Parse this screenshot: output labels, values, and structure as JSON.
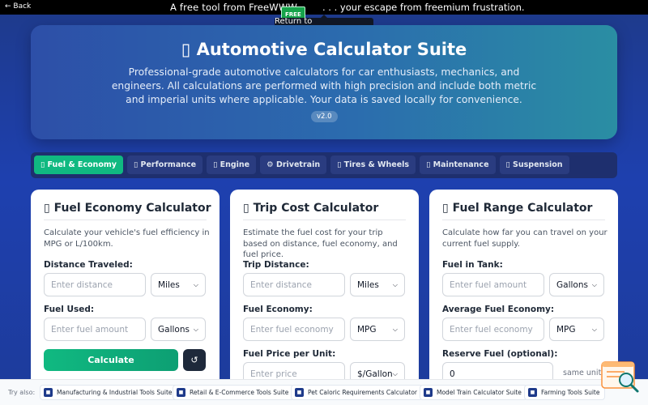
{
  "topbar": {
    "back_label": "← Back",
    "banner_text": "A free tool from FreeWWW",
    "logo_text": "FREE",
    "banner_tail": ". . . your escape from freemium frustration.",
    "return_tooltip": "Return to FreeWWW.com"
  },
  "hero": {
    "title": "▯ Automotive Calculator Suite",
    "description": "Professional-grade automotive calculators for car enthusiasts, mechanics, and engineers. All calculations are performed with high precision and include both metric and imperial units where applicable. Your data is saved locally for convenience.",
    "version": "v2.0"
  },
  "tabs": [
    {
      "label": "▯ Fuel & Economy"
    },
    {
      "label": "▯ Performance"
    },
    {
      "label": "▯ Engine"
    },
    {
      "label": "⚙ Drivetrain"
    },
    {
      "label": "▯ Tires & Wheels"
    },
    {
      "label": "▯ Maintenance"
    },
    {
      "label": "▯ Suspension"
    }
  ],
  "cards": {
    "fuel_economy": {
      "title": "▯ Fuel Economy Calculator",
      "description": "Calculate your vehicle's fuel efficiency in MPG or L/100km.",
      "distance_label": "Distance Traveled:",
      "distance_placeholder": "Enter distance",
      "distance_unit": "Miles",
      "fuel_label": "Fuel Used:",
      "fuel_placeholder": "Enter fuel amount",
      "fuel_unit": "Gallons",
      "calculate_label": "Calculate",
      "reset_label": "↺"
    },
    "trip_cost": {
      "title": "▯ Trip Cost Calculator",
      "description": "Estimate the fuel cost for your trip based on distance, fuel economy, and fuel price.",
      "distance_label": "Trip Distance:",
      "distance_placeholder": "Enter distance",
      "distance_unit": "Miles",
      "economy_label": "Fuel Economy:",
      "economy_placeholder": "Enter fuel economy",
      "economy_unit": "MPG",
      "price_label": "Fuel Price per Unit:",
      "price_placeholder": "Enter price",
      "price_unit": "$/Gallon"
    },
    "fuel_range": {
      "title": "▯ Fuel Range Calculator",
      "description": "Calculate how far you can travel on your current fuel supply.",
      "fuel_label": "Fuel in Tank:",
      "fuel_placeholder": "Enter fuel amount",
      "fuel_unit": "Gallons",
      "economy_label": "Average Fuel Economy:",
      "economy_placeholder": "Enter fuel economy",
      "economy_unit": "MPG",
      "reserve_label": "Reserve Fuel (optional):",
      "reserve_value": "0",
      "reserve_unit_note": "same unit"
    }
  },
  "bottombar": {
    "try_also": "Try also:",
    "links": [
      {
        "label": "Manufacturing & Industrial Tools Suite"
      },
      {
        "label": "Retail & E-Commerce Tools Suite"
      },
      {
        "label": "Pet Caloric Requirements Calculator"
      },
      {
        "label": "Model Train Calculator Suite"
      },
      {
        "label": "Farming Tools Suite"
      }
    ]
  },
  "colors": {
    "accent": "#10b981",
    "background": "#1e40af",
    "dark": "#1e293b"
  }
}
